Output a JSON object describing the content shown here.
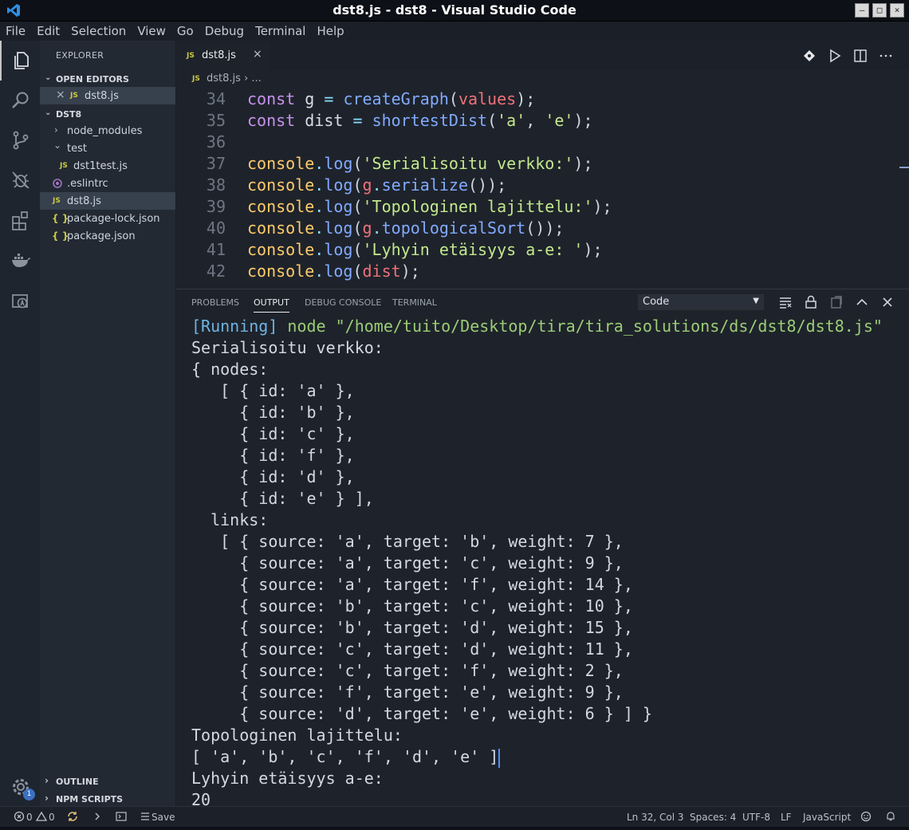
{
  "window": {
    "title": "dst8.js - dst8 - Visual Studio Code",
    "min": "–",
    "max": "□",
    "close": "×"
  },
  "menu": [
    "File",
    "Edit",
    "Selection",
    "View",
    "Go",
    "Debug",
    "Terminal",
    "Help"
  ],
  "activity": [
    "files-icon",
    "search-icon",
    "source-control-icon",
    "debug-icon",
    "extensions-icon",
    "docker-icon",
    "live-share-icon",
    "settings-gear-icon"
  ],
  "settings_badge": "1",
  "sidebar": {
    "heading": "EXPLORER",
    "open_editors": {
      "label": "OPEN EDITORS",
      "items": [
        {
          "close": "×",
          "badge": "JS",
          "name": "dst8.js"
        }
      ]
    },
    "project": {
      "label": "DST8",
      "items": [
        {
          "name": "node_modules",
          "chev": "›"
        },
        {
          "name": "test",
          "chev": "⌄"
        },
        {
          "name": "dst1test.js",
          "badge": "JS"
        },
        {
          "name": ".eslintrc"
        },
        {
          "name": "dst8.js",
          "badge": "JS"
        },
        {
          "name": "package-lock.json",
          "badge": "{ }"
        },
        {
          "name": "package.json",
          "badge": "{ }"
        }
      ]
    },
    "outline": "OUTLINE",
    "npm_scripts": "NPM SCRIPTS"
  },
  "editor": {
    "tab": {
      "badge": "JS",
      "name": "dst8.js",
      "close": "×"
    },
    "breadcrumb": {
      "badge": "JS",
      "file": "dst8.js",
      "sep": "›",
      "rest": "..."
    },
    "lines": [
      {
        "n": "34",
        "parts": [
          [
            "kw",
            "const "
          ],
          [
            "vr",
            "g "
          ],
          [
            "pun",
            "= "
          ],
          [
            "fn",
            "createGraph"
          ],
          [
            "plain",
            "("
          ],
          [
            "par",
            "values"
          ],
          [
            "plain",
            ");"
          ]
        ]
      },
      {
        "n": "35",
        "parts": [
          [
            "kw",
            "const "
          ],
          [
            "vr",
            "dist "
          ],
          [
            "pun",
            "= "
          ],
          [
            "fn",
            "shortestDist"
          ],
          [
            "plain",
            "("
          ],
          [
            "str",
            "'a'"
          ],
          [
            "plain",
            ", "
          ],
          [
            "str",
            "'e'"
          ],
          [
            "plain",
            ");"
          ]
        ]
      },
      {
        "n": "36",
        "parts": []
      },
      {
        "n": "37",
        "parts": [
          [
            "obj",
            "console"
          ],
          [
            "pun",
            "."
          ],
          [
            "fn",
            "log"
          ],
          [
            "plain",
            "("
          ],
          [
            "str",
            "'Serialisoitu verkko:'"
          ],
          [
            "plain",
            ");"
          ]
        ]
      },
      {
        "n": "38",
        "parts": [
          [
            "obj",
            "console"
          ],
          [
            "pun",
            "."
          ],
          [
            "fn",
            "log"
          ],
          [
            "plain",
            "("
          ],
          [
            "par",
            "g"
          ],
          [
            "pun",
            "."
          ],
          [
            "fn",
            "serialize"
          ],
          [
            "plain",
            "());"
          ]
        ]
      },
      {
        "n": "39",
        "parts": [
          [
            "obj",
            "console"
          ],
          [
            "pun",
            "."
          ],
          [
            "fn",
            "log"
          ],
          [
            "plain",
            "("
          ],
          [
            "str",
            "'Topologinen lajittelu:'"
          ],
          [
            "plain",
            ");"
          ]
        ]
      },
      {
        "n": "40",
        "parts": [
          [
            "obj",
            "console"
          ],
          [
            "pun",
            "."
          ],
          [
            "fn",
            "log"
          ],
          [
            "plain",
            "("
          ],
          [
            "par",
            "g"
          ],
          [
            "pun",
            "."
          ],
          [
            "fn",
            "topologicalSort"
          ],
          [
            "plain",
            "());"
          ]
        ]
      },
      {
        "n": "41",
        "parts": [
          [
            "obj",
            "console"
          ],
          [
            "pun",
            "."
          ],
          [
            "fn",
            "log"
          ],
          [
            "plain",
            "("
          ],
          [
            "str",
            "'Lyhyin etäisyys a-e: '"
          ],
          [
            "plain",
            ");"
          ]
        ]
      },
      {
        "n": "42",
        "parts": [
          [
            "obj",
            "console"
          ],
          [
            "pun",
            "."
          ],
          [
            "fn",
            "log"
          ],
          [
            "plain",
            "("
          ],
          [
            "par",
            "dist"
          ],
          [
            "plain",
            ");"
          ]
        ]
      }
    ]
  },
  "panel": {
    "tabs": [
      "PROBLEMS",
      "OUTPUT",
      "DEBUG CONSOLE",
      "TERMINAL"
    ],
    "active_tab": "OUTPUT",
    "channel": "Code",
    "running_tag": "[Running]",
    "running_cmd": " node \"/home/tuito/Desktop/tira/tira_solutions/ds/dst8/dst8.js\"",
    "output": [
      "Serialisoitu verkko:",
      "{ nodes:",
      "   [ { id: 'a' },",
      "     { id: 'b' },",
      "     { id: 'c' },",
      "     { id: 'f' },",
      "     { id: 'd' },",
      "     { id: 'e' } ],",
      "  links:",
      "   [ { source: 'a', target: 'b', weight: 7 },",
      "     { source: 'a', target: 'c', weight: 9 },",
      "     { source: 'a', target: 'f', weight: 14 },",
      "     { source: 'b', target: 'c', weight: 10 },",
      "     { source: 'b', target: 'd', weight: 15 },",
      "     { source: 'c', target: 'd', weight: 11 },",
      "     { source: 'c', target: 'f', weight: 2 },",
      "     { source: 'f', target: 'e', weight: 9 },",
      "     { source: 'd', target: 'e', weight: 6 } ] }",
      "Topologinen lajittelu:",
      "[ 'a', 'b', 'c', 'f', 'd', 'e' ]",
      "Lyhyin etäisyys a-e:",
      "20"
    ]
  },
  "status": {
    "errors": "0",
    "warnings": "0",
    "save": "Save",
    "position": "Ln 32, Col 3",
    "spaces": "Spaces: 4",
    "encoding": "UTF-8",
    "eol": "LF",
    "language": "JavaScript"
  }
}
